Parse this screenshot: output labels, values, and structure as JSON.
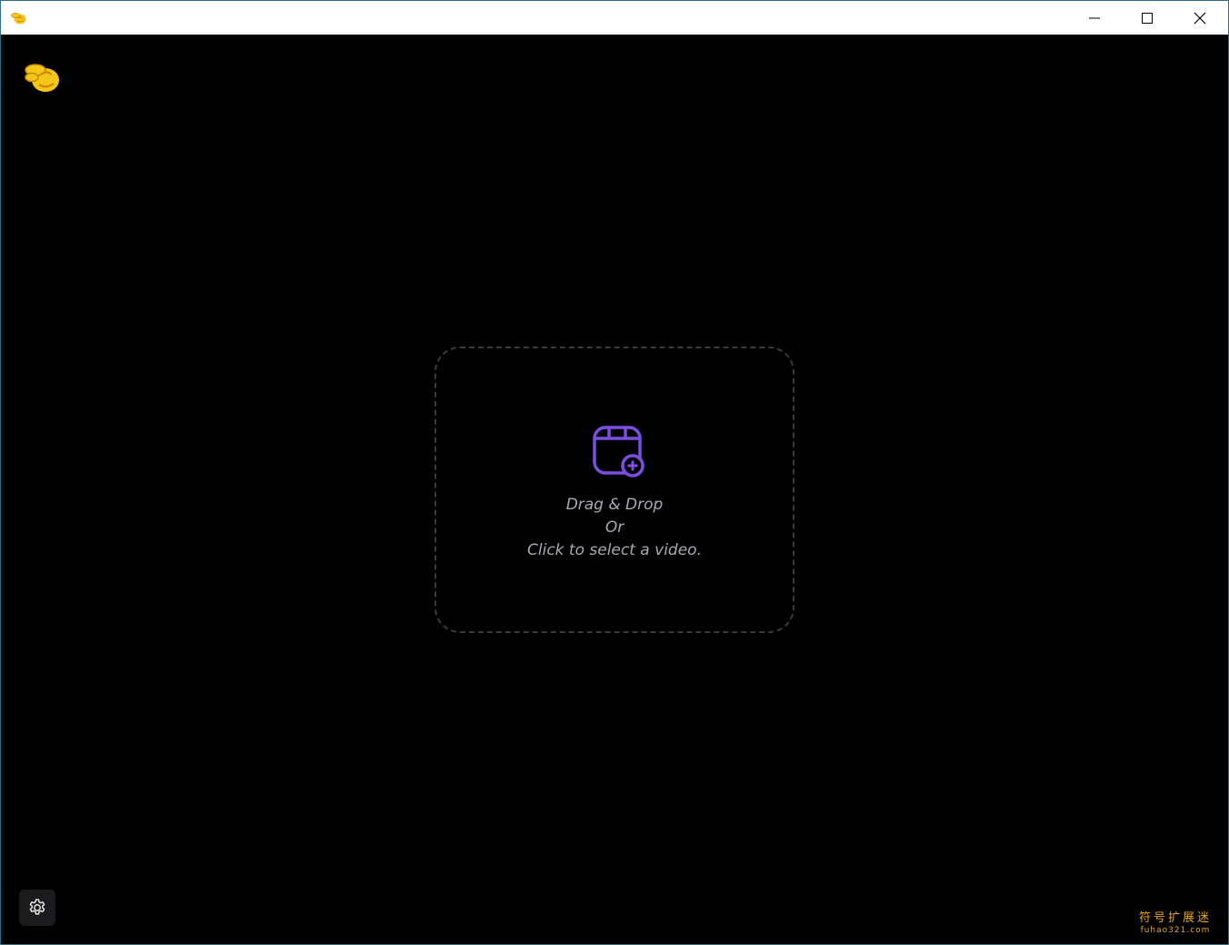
{
  "window": {
    "app_icon": "pinched-fingers-emoji-icon",
    "controls": {
      "minimize": "minimize-icon",
      "maximize": "maximize-icon",
      "close": "close-icon"
    }
  },
  "app": {
    "logo": "pinched-fingers-emoji-icon"
  },
  "dropzone": {
    "icon": "video-add-icon",
    "accent_color": "#7b4de0",
    "line1": "Drag & Drop",
    "line2": "Or",
    "line3": "Click to select a video."
  },
  "settings": {
    "icon": "gear-icon"
  },
  "watermark": {
    "title": "符号扩展迷",
    "url": "fuhao321.com"
  },
  "colors": {
    "background": "#000000",
    "titlebar": "#ffffff",
    "emoji": "#f5c518",
    "watermark": "#e6a619"
  }
}
